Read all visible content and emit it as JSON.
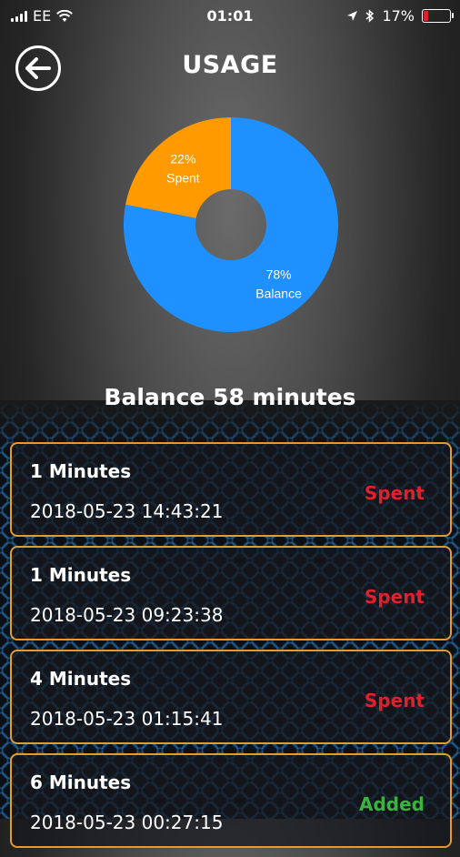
{
  "status_bar": {
    "carrier": "EE",
    "time": "01:01",
    "battery": "17%",
    "battery_level": 0.17,
    "battery_color": "#e0202a"
  },
  "header": {
    "title": "USAGE",
    "back_icon": "arrow-left-circle-icon"
  },
  "chart_data": {
    "type": "pie",
    "donut": true,
    "slices": [
      {
        "percent": 78,
        "label": "78%",
        "name": "Balance",
        "color": "#1e90ff"
      },
      {
        "percent": 22,
        "label": "22%",
        "name": "Spent",
        "color": "#ff9a00"
      }
    ]
  },
  "balance": {
    "text": "Balance 58 minutes"
  },
  "usage": {
    "items": [
      {
        "amount": "1 Minutes",
        "date": "2018-05-23 14:43:21",
        "type": "Spent",
        "color": "#e0202a"
      },
      {
        "amount": "1 Minutes",
        "date": "2018-05-23 09:23:38",
        "type": "Spent",
        "color": "#e0202a"
      },
      {
        "amount": "4 Minutes",
        "date": "2018-05-23 01:15:41",
        "type": "Spent",
        "color": "#e0202a"
      },
      {
        "amount": "6 Minutes",
        "date": "2018-05-23 00:27:15",
        "type": "Added",
        "color": "#3cb33c"
      }
    ]
  }
}
